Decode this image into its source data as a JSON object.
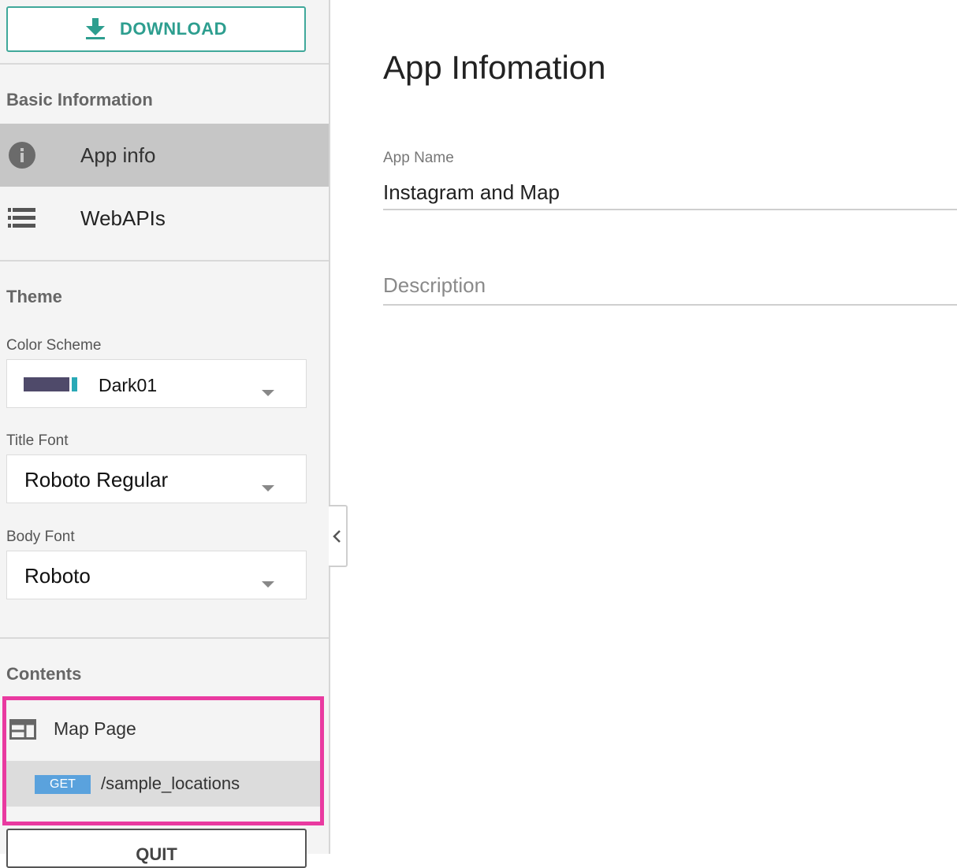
{
  "sidebar": {
    "download_label": "DOWNLOAD",
    "basic_section": "Basic Information",
    "nav": [
      {
        "label": "App info",
        "icon": "info-icon",
        "active": true
      },
      {
        "label": "WebAPIs",
        "icon": "list-icon",
        "active": false
      }
    ],
    "theme_section": "Theme",
    "color_scheme": {
      "label": "Color Scheme",
      "value": "Dark01",
      "swatch_primary": "#4f4a6a",
      "swatch_accent": "#29a9b6"
    },
    "title_font": {
      "label": "Title Font",
      "value": "Roboto Regular"
    },
    "body_font": {
      "label": "Body Font",
      "value": "Roboto"
    },
    "contents_section": "Contents",
    "contents": {
      "page_label": "Map Page",
      "page_icon": "page-layout-icon",
      "endpoint_method": "GET",
      "endpoint_path": "/sample_locations"
    },
    "quit_label": "QUIT"
  },
  "main": {
    "title": "App Infomation",
    "app_name_label": "App Name",
    "app_name_value": "Instagram and Map",
    "description_placeholder": "Description"
  },
  "colors": {
    "accent": "#2d9e8f",
    "highlight": "#e93aa0",
    "get_badge": "#5aa2dd"
  }
}
